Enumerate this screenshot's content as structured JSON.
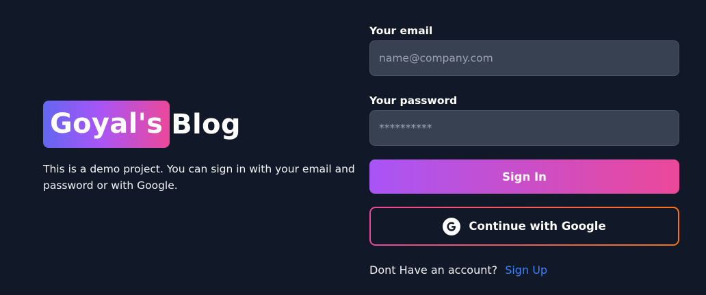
{
  "brand": {
    "logo_highlight": "Goyal's",
    "logo_word": "Blog",
    "tagline": "This is a demo project. You can sign in with your email and password or with Google."
  },
  "form": {
    "email_label": "Your email",
    "email_placeholder": "name@company.com",
    "email_value": "",
    "password_label": "Your password",
    "password_placeholder": "**********",
    "password_value": "",
    "signin_label": "Sign In",
    "google_label": "Continue with Google",
    "google_icon": "google-icon",
    "signup_prompt": "Dont Have an account?",
    "signup_link": "Sign Up"
  },
  "colors": {
    "background": "#111827",
    "input_bg": "#374151",
    "gradient_start": "#a855f7",
    "gradient_end": "#ec4899",
    "google_border_end": "#f97316",
    "link": "#3b82f6"
  }
}
